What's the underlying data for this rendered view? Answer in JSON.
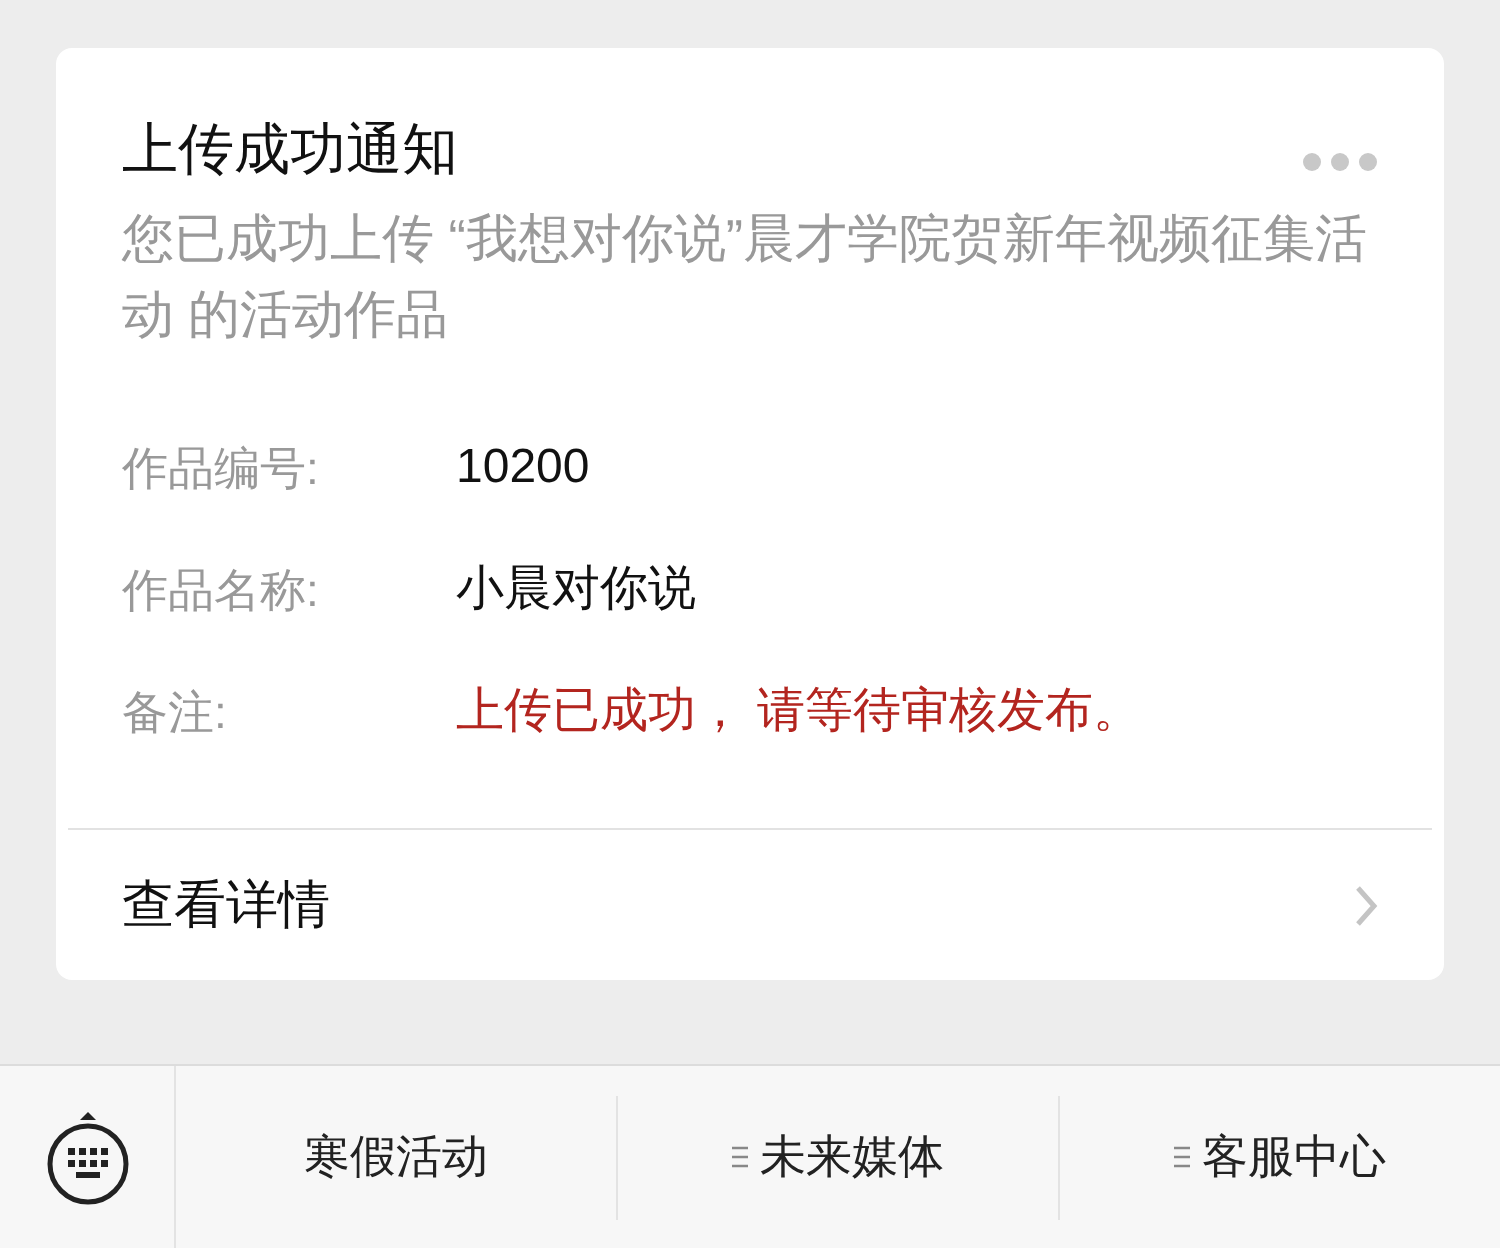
{
  "card": {
    "title": "上传成功通知",
    "description": "您已成功上传 “我想对你说”晨才学院贺新年视频征集活动 的活动作品",
    "fields": [
      {
        "label": "作品编号:",
        "value": "10200",
        "kind": "normal"
      },
      {
        "label": "作品名称:",
        "value": "小晨对你说",
        "kind": "normal"
      },
      {
        "label": "备注:",
        "value": "上传已成功， 请等待审核发布。",
        "kind": "highlight"
      }
    ],
    "link": "查看详情"
  },
  "menu_bar": {
    "items": [
      {
        "label": "寒假活动",
        "has_submenu": false
      },
      {
        "label": "未来媒体",
        "has_submenu": true
      },
      {
        "label": "客服中心",
        "has_submenu": true
      }
    ]
  }
}
